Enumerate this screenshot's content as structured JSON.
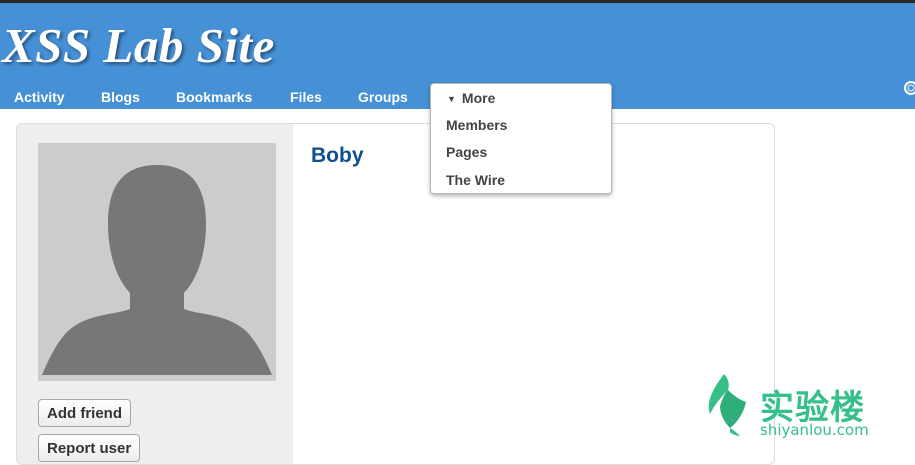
{
  "site": {
    "title": "XSS Lab Site"
  },
  "nav": {
    "items": [
      {
        "label": "Activity"
      },
      {
        "label": "Blogs"
      },
      {
        "label": "Bookmarks"
      },
      {
        "label": "Files"
      },
      {
        "label": "Groups"
      }
    ],
    "more": {
      "label": "More",
      "arrow": "▼",
      "items": [
        {
          "label": "Members"
        },
        {
          "label": "Pages"
        },
        {
          "label": "The Wire"
        }
      ]
    },
    "search_icon": "search-icon"
  },
  "profile": {
    "name": "Boby",
    "avatar_icon": "default-user-silhouette",
    "actions": {
      "add_friend": "Add friend",
      "report_user": "Report user"
    }
  },
  "watermark": {
    "text": "实验楼",
    "url": "shiyanlou.com",
    "color": "#35c08a"
  },
  "colors": {
    "header_bg": "#4690d6",
    "name_link": "#0d4f8f",
    "sidebar_bg": "#eeeeee"
  }
}
